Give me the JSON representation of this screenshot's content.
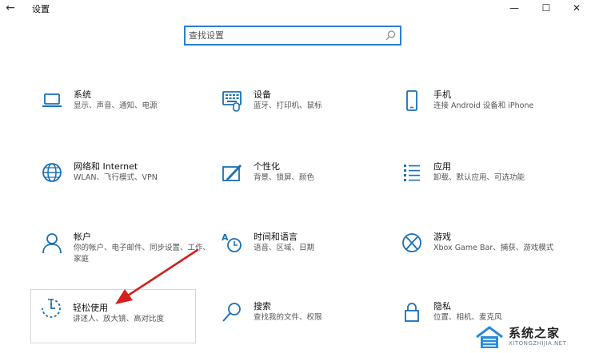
{
  "window": {
    "title": "设置",
    "back_glyph": "←",
    "minimize_glyph": "—",
    "maximize_glyph": "☐",
    "close_glyph": "✕"
  },
  "search": {
    "placeholder": "查找设置"
  },
  "tiles": [
    {
      "name": "系统",
      "desc": "显示、声音、通知、电源",
      "icon": "laptop-icon"
    },
    {
      "name": "设备",
      "desc": "蓝牙、打印机、鼠标",
      "icon": "keyboard-icon"
    },
    {
      "name": "手机",
      "desc": "连接 Android 设备和 iPhone",
      "icon": "phone-icon"
    },
    {
      "name": "网络和 Internet",
      "desc": "WLAN、飞行模式、VPN",
      "icon": "globe-icon"
    },
    {
      "name": "个性化",
      "desc": "背景、锁屏、颜色",
      "icon": "brush-icon"
    },
    {
      "name": "应用",
      "desc": "卸载、默认应用、可选功能",
      "icon": "apps-list-icon"
    },
    {
      "name": "帐户",
      "desc": "你的帐户、电子邮件、同步设置、工作、家庭",
      "icon": "person-icon"
    },
    {
      "name": "时间和语言",
      "desc": "语音、区域、日期",
      "icon": "time-language-icon"
    },
    {
      "name": "游戏",
      "desc": "Xbox Game Bar、捕获、游戏模式",
      "icon": "xbox-icon"
    },
    {
      "name": "轻松使用",
      "desc": "讲述人、放大镜、高对比度",
      "icon": "ease-of-access-icon"
    },
    {
      "name": "搜索",
      "desc": "查找我的文件、权限",
      "icon": "search-icon"
    },
    {
      "name": "隐私",
      "desc": "位置、相机、麦克风",
      "icon": "lock-icon"
    }
  ],
  "watermark": {
    "text": "系统之家",
    "sub": "XITONGZHIJIA.NET"
  },
  "colors": {
    "accent": "#1a6fb5",
    "search_border": "#2a7fd0",
    "arrow": "#d32020"
  }
}
